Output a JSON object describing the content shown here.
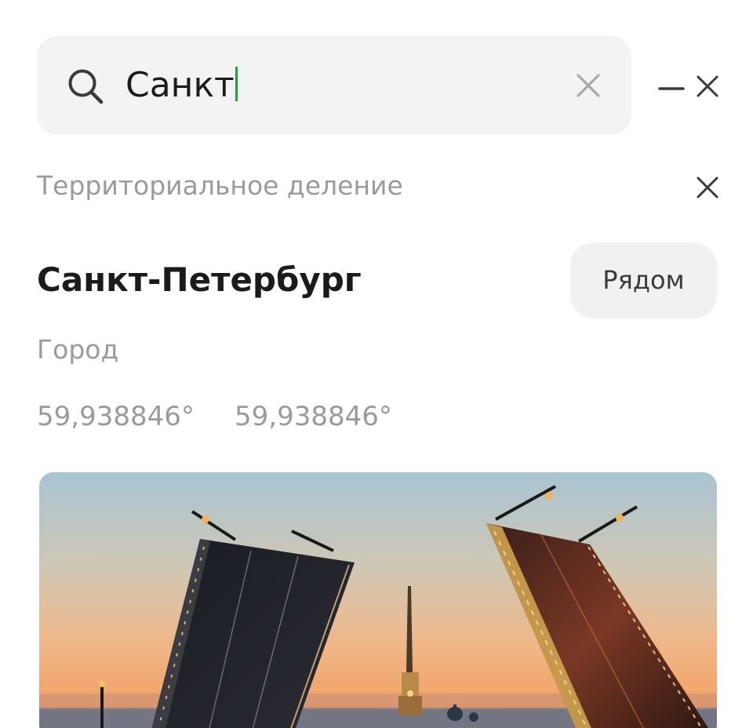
{
  "search": {
    "value": "Санкт"
  },
  "section": {
    "label": "Территориальное деление"
  },
  "place": {
    "title": "Санкт-Петербург",
    "nearby_label": "Рядом",
    "type": "Город",
    "latitude": "59,938846°",
    "longitude": "59,938846°",
    "photo_subject": "raised drawbridge at sunset"
  },
  "colors": {
    "caret": "#21a038",
    "search_bg": "#f3f3f3",
    "muted_text": "#9a9a9a",
    "primary_text": "#1b1b1b"
  },
  "icons": {
    "search": "search-icon",
    "clear": "close-icon",
    "minimize": "minimize-icon",
    "close": "close-icon"
  }
}
